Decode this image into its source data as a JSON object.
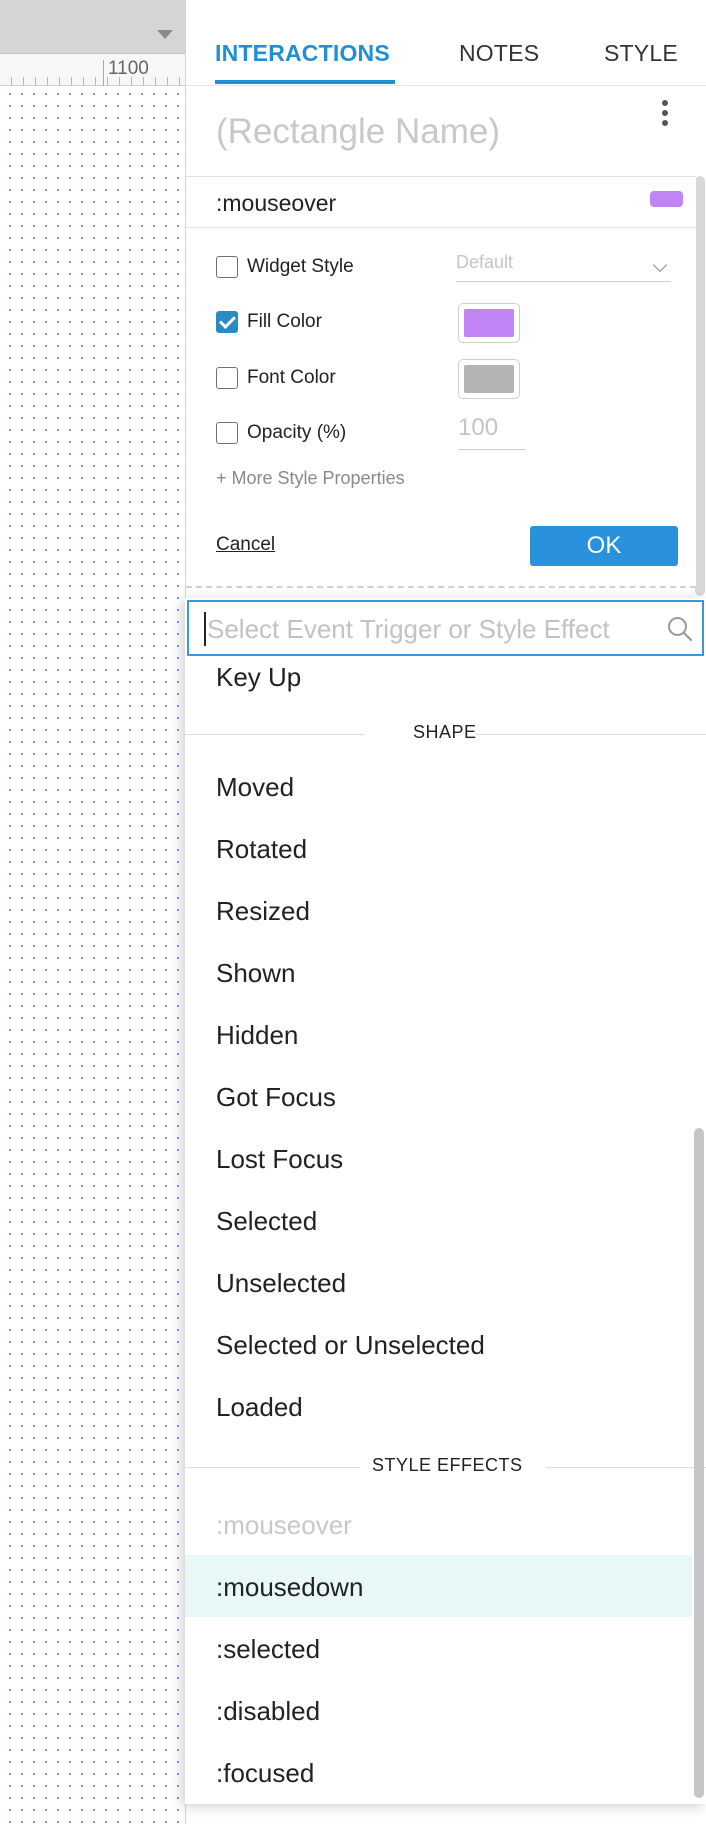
{
  "canvas": {
    "ruler_label": "1100"
  },
  "panel": {
    "tabs": [
      {
        "label": "INTERACTIONS",
        "active": true
      },
      {
        "label": "NOTES",
        "active": false
      },
      {
        "label": "STYLE",
        "active": false
      }
    ],
    "name_placeholder": "(Rectangle Name)",
    "accent_color": "#1f8fd6"
  },
  "style_editor": {
    "state": ":mouseover",
    "state_swatch_color": "#c084f4",
    "options": {
      "widget_style": {
        "label": "Widget Style",
        "checked": false,
        "value": "Default"
      },
      "fill_color": {
        "label": "Fill Color",
        "checked": true,
        "color": "#c084f4"
      },
      "font_color": {
        "label": "Font Color",
        "checked": false,
        "color": "#b4b4b4"
      },
      "opacity": {
        "label": "Opacity (%)",
        "checked": false,
        "value": "100"
      }
    },
    "more_properties": "+ More Style Properties",
    "cancel_label": "Cancel",
    "ok_label": "OK"
  },
  "dropdown": {
    "search_placeholder": "Select Event Trigger or Style Effect",
    "search_icon": "search-icon",
    "top_item": "Key Up",
    "shape_header": "SHAPE",
    "shape_items": [
      "Moved",
      "Rotated",
      "Resized",
      "Shown",
      "Hidden",
      "Got Focus",
      "Lost Focus",
      "Selected",
      "Unselected",
      "Selected or Unselected",
      "Loaded"
    ],
    "style_effects_header": "STYLE EFFECTS",
    "style_effect_items": [
      {
        "label": ":mouseover",
        "disabled": true,
        "highlighted": false
      },
      {
        "label": ":mousedown",
        "disabled": false,
        "highlighted": true
      },
      {
        "label": ":selected",
        "disabled": false,
        "highlighted": false
      },
      {
        "label": ":disabled",
        "disabled": false,
        "highlighted": false
      },
      {
        "label": ":focused",
        "disabled": false,
        "highlighted": false
      }
    ]
  }
}
